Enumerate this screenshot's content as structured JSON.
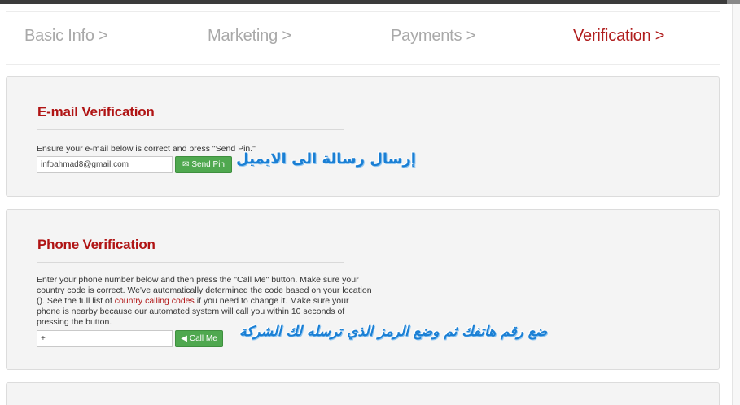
{
  "steps": [
    {
      "label": "Basic Info >",
      "active": false
    },
    {
      "label": "Marketing >",
      "active": false
    },
    {
      "label": "Payments >",
      "active": false
    },
    {
      "label": "Verification >",
      "active": true
    }
  ],
  "email_section": {
    "title": "E-mail Verification",
    "hint": "Ensure your e-mail below is correct and press \"Send Pin.\"",
    "email_value": "infoahmad8@gmail.com",
    "send_pin_label": "Send Pin",
    "annotation": "إرسال رسالة الى الايميل"
  },
  "phone_section": {
    "title": "Phone Verification",
    "hint_line1": "Enter your phone number below and then press the \"Call Me\" button. Make sure your",
    "hint_line2": "country code is correct. We've automatically determined the code based on your location",
    "hint_line3a": "(). See the full list of ",
    "hint_link": "country calling codes",
    "hint_line3b": " if you need to change it. Make sure your",
    "hint_line4": "phone is nearby because our automated system will call you within 10 seconds of",
    "hint_line5": "pressing the button.",
    "phone_value": "+",
    "call_me_label": "Call Me",
    "annotation": "ضع رقم هاتفك ثم وضع الرمز الذي ترسله لك الشركة"
  },
  "colors": {
    "accent": "#b01414",
    "button_green": "#4fa84f",
    "annotation_blue": "#1a7fd4"
  },
  "icons": {
    "send_pin": "envelope-icon",
    "call_me": "megaphone-icon"
  }
}
